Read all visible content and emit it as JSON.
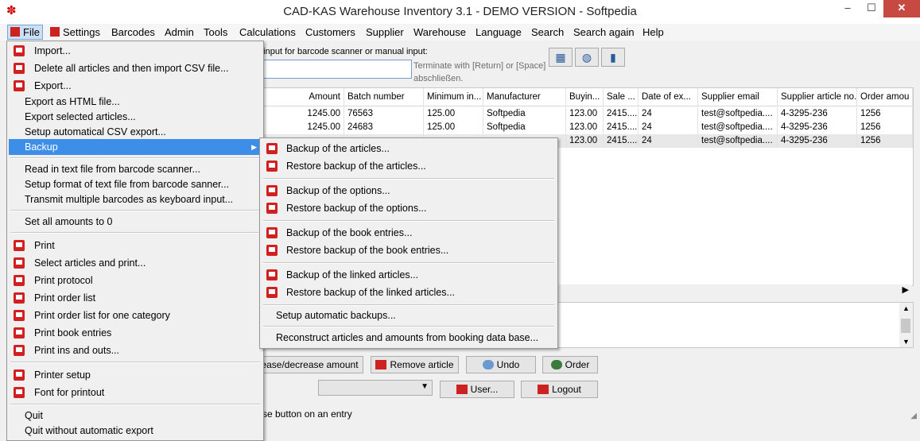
{
  "window": {
    "title": "CAD-KAS Warehouse Inventory 3.1 - DEMO VERSION - Softpedia",
    "minimize": "–",
    "maximize": "☐",
    "close": "✕"
  },
  "menubar": {
    "items": [
      "File",
      "Settings",
      "Barcodes",
      "Admin",
      "Tools",
      "Calculations",
      "Customers",
      "Supplier",
      "Warehouse",
      "Language",
      "Search",
      "Search again",
      "Help"
    ]
  },
  "scanner": {
    "label": "e input for barcode scanner or manual input:",
    "value": "",
    "terminate_hint": "Terminate with [Return] or [Space] abschließen."
  },
  "toolbar_icons": [
    "calculator-icon",
    "globe-icon",
    "book-icon"
  ],
  "grid": {
    "columns": [
      "Amount",
      "Batch number",
      "Minimum in...",
      "Manufacturer",
      "Buyin...",
      "Sale ...",
      "Date of ex...",
      "Supplier email",
      "Supplier article no.",
      "Order amou"
    ],
    "rows": [
      [
        "1245.00",
        "76563",
        "125.00",
        "Softpedia",
        "123.00",
        "2415....",
        "24",
        "test@softpedia....",
        "4-3295-236",
        "1256"
      ],
      [
        "1245.00",
        "24683",
        "125.00",
        "Softpedia",
        "123.00",
        "2415....",
        "24",
        "test@softpedia....",
        "4-3295-236",
        "1256"
      ],
      [
        "",
        "",
        "",
        "",
        "123.00",
        "2415....",
        "24",
        "test@softpedia....",
        "4-3295-236",
        "1256"
      ]
    ]
  },
  "buttons": {
    "increase": "ease/decrease amount",
    "remove": "Remove article",
    "undo": "Undo",
    "order": "Order",
    "user": "User...",
    "logout": "Logout"
  },
  "status": "se button on an entry",
  "file_menu": {
    "items": [
      {
        "label": "Import...",
        "icon": true
      },
      {
        "label": "Delete all articles and then import CSV file...",
        "icon": true
      },
      {
        "label": "Export...",
        "icon": true
      },
      {
        "label": "Export as HTML file..."
      },
      {
        "label": "Export selected articles..."
      },
      {
        "label": "Setup automatical CSV export..."
      },
      {
        "label": "Backup",
        "submenu": true
      },
      {
        "label": "Read in text file from barcode scanner..."
      },
      {
        "label": "Setup format of text file from barcode sanner..."
      },
      {
        "label": "Transmit multiple barcodes as keyboard input..."
      },
      {
        "label": "Set all amounts to 0"
      },
      {
        "label": "Print",
        "icon": true
      },
      {
        "label": "Select articles and print...",
        "icon": true
      },
      {
        "label": "Print protocol",
        "icon": true
      },
      {
        "label": "Print order list",
        "icon": true
      },
      {
        "label": "Print order list for one category",
        "icon": true
      },
      {
        "label": "Print book entries",
        "icon": true
      },
      {
        "label": "Print ins and outs...",
        "icon": true
      },
      {
        "label": "Printer setup",
        "icon": true
      },
      {
        "label": "Font for printout",
        "icon": true
      },
      {
        "label": "Quit"
      },
      {
        "label": "Quit without automatic export"
      }
    ]
  },
  "backup_menu": {
    "items": [
      {
        "label": "Backup of the articles...",
        "icon": true
      },
      {
        "label": "Restore backup of the articles...",
        "icon": true
      },
      {
        "label": "Backup of the options...",
        "icon": true
      },
      {
        "label": "Restore backup of the options...",
        "icon": true
      },
      {
        "label": "Backup of the book entries...",
        "icon": true
      },
      {
        "label": "Restore backup of the book entries...",
        "icon": true
      },
      {
        "label": "Backup of the linked articles...",
        "icon": true
      },
      {
        "label": "Restore backup of the linked articles...",
        "icon": true
      },
      {
        "label": "Setup automatic backups..."
      },
      {
        "label": "Reconstruct articles and amounts from booking data base..."
      }
    ]
  }
}
